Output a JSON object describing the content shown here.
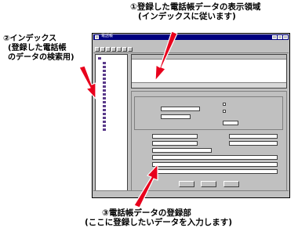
{
  "annotations": {
    "display_area": {
      "line1": "①登録した電話帳データの表示領域",
      "line2": "(インデックスに従います)"
    },
    "index": {
      "line1": "②インデックス",
      "line2": "(登録した電話帳",
      "line3": "のデータの検索用)"
    },
    "entry_area": {
      "line1": "③電話帳データの登録部",
      "line2": "(ここに登録したいデータを入力します)"
    }
  },
  "window": {
    "title": "電話帳"
  },
  "icons": [
    "system-menu-icon",
    "minimize-icon",
    "maximize-icon",
    "close-icon",
    "folder-icon",
    "toolbar-icon",
    "arrow-icon"
  ],
  "colors": {
    "arrow": "#e8001c",
    "titlebar": "#000080",
    "face": "#c0c0c0",
    "folder": "#5a3a8a"
  }
}
